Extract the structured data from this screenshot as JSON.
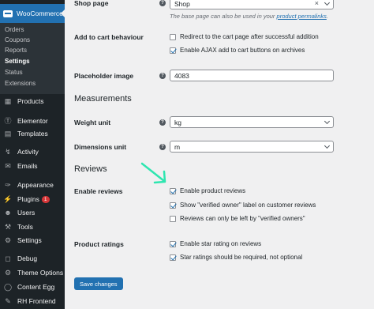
{
  "sidebar": {
    "woocommerce_label": "WooCommerce",
    "submenu": [
      "Orders",
      "Coupons",
      "Reports",
      "Settings",
      "Status",
      "Extensions"
    ],
    "menu": [
      {
        "label": "Products",
        "icon": "products-icon"
      },
      {
        "label": "Elementor",
        "icon": "elementor-icon"
      },
      {
        "label": "Templates",
        "icon": "templates-icon"
      },
      {
        "label": "Activity",
        "icon": "activity-icon"
      },
      {
        "label": "Emails",
        "icon": "emails-icon"
      },
      {
        "label": "Appearance",
        "icon": "appearance-icon"
      },
      {
        "label": "Plugins",
        "icon": "plugins-icon",
        "badge": "1"
      },
      {
        "label": "Users",
        "icon": "users-icon"
      },
      {
        "label": "Tools",
        "icon": "tools-icon"
      },
      {
        "label": "Settings",
        "icon": "settings-icon"
      },
      {
        "label": "Debug",
        "icon": "debug-icon"
      },
      {
        "label": "Theme Options",
        "icon": "theme-options-icon"
      },
      {
        "label": "Content Egg",
        "icon": "content-egg-icon"
      },
      {
        "label": "RH Frontend",
        "icon": "rh-frontend-icon"
      }
    ]
  },
  "settings": {
    "shop_page": {
      "label": "Shop page",
      "value": "Shop",
      "clear": "×",
      "description": "The base page can also be used in your",
      "link": "product permalinks",
      "description_end": "."
    },
    "add_to_cart": {
      "label": "Add to cart behaviour",
      "opt1": "Redirect to the cart page after successful addition",
      "opt2": "Enable AJAX add to cart buttons on archives"
    },
    "placeholder": {
      "label": "Placeholder image",
      "value": "4083"
    },
    "measurements_heading": "Measurements",
    "weight": {
      "label": "Weight unit",
      "value": "kg"
    },
    "dimensions": {
      "label": "Dimensions unit",
      "value": "m"
    },
    "reviews_heading": "Reviews",
    "enable_reviews": {
      "label": "Enable reviews",
      "opt1": "Enable product reviews",
      "opt2": "Show \"verified owner\" label on customer reviews",
      "opt3": "Reviews can only be left by \"verified owners\""
    },
    "ratings": {
      "label": "Product ratings",
      "opt1": "Enable star rating on reviews",
      "opt2": "Star ratings should be required, not optional"
    },
    "save_label": "Save changes",
    "help_glyph": "?"
  },
  "colors": {
    "accent": "#2271b1",
    "sidebar": "#1d2327",
    "arrow": "#2ee6b0",
    "badge": "#d63638"
  }
}
